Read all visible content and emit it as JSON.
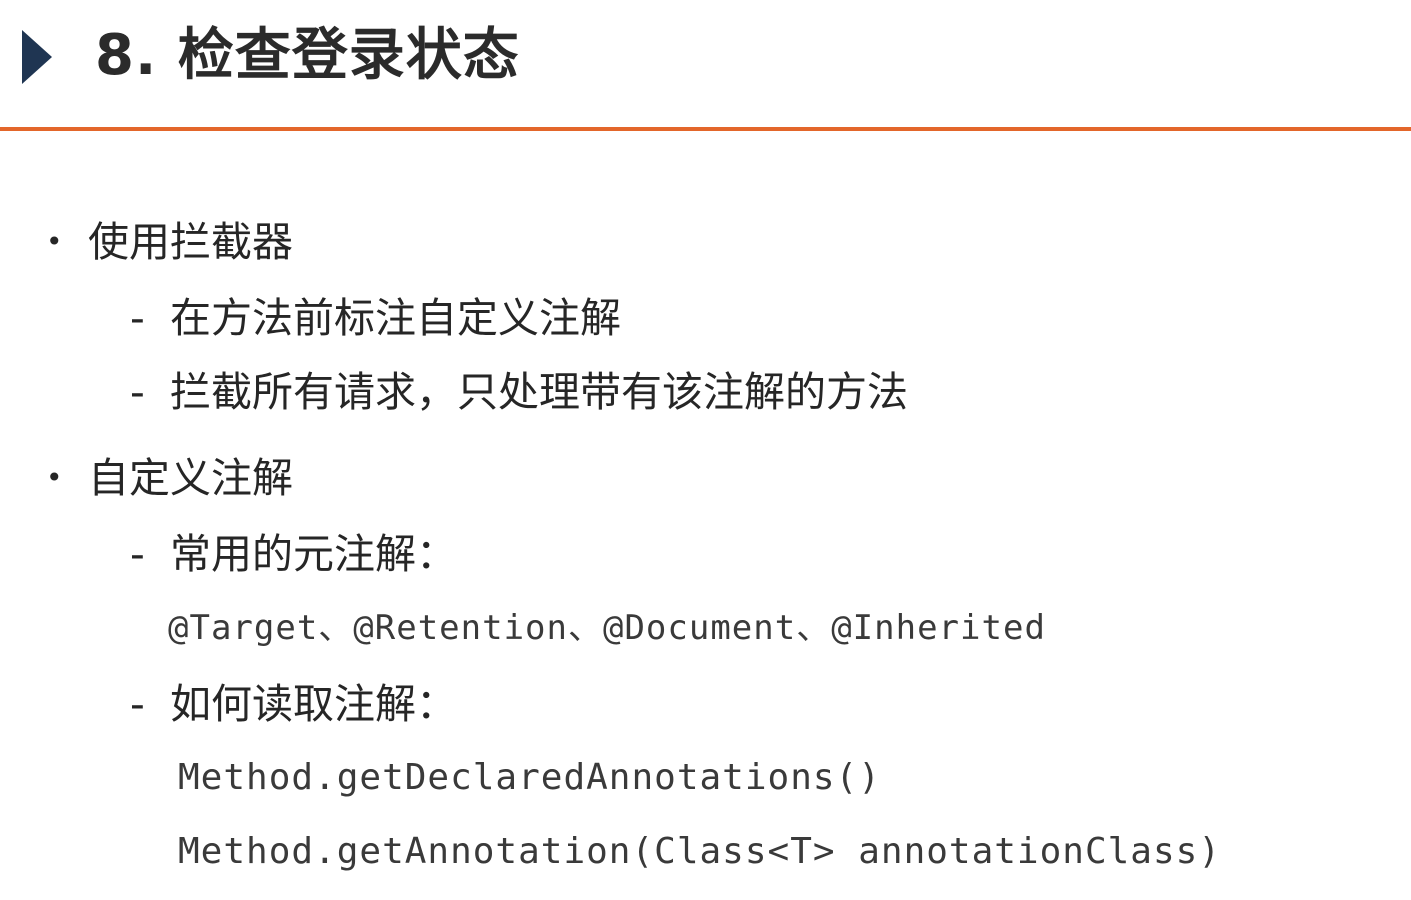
{
  "slide": {
    "title": "8. 检查登录状态",
    "bullets": [
      {
        "text": "使用拦截器",
        "subs": [
          "在方法前标注自定义注解",
          "拦截所有请求，只处理带有该注解的方法"
        ]
      },
      {
        "text": "自定义注解",
        "subs": [
          "常用的元注解：",
          "如何读取注解："
        ]
      }
    ],
    "code": {
      "meta_annotations": "@Target、@Retention、@Document、@Inherited",
      "read_line_1": "Method.getDeclaredAnnotations()",
      "read_line_2": "Method.getAnnotation(Class<T> annotationClass)"
    },
    "bullet_symbol": "•",
    "dash_symbol": "-"
  }
}
